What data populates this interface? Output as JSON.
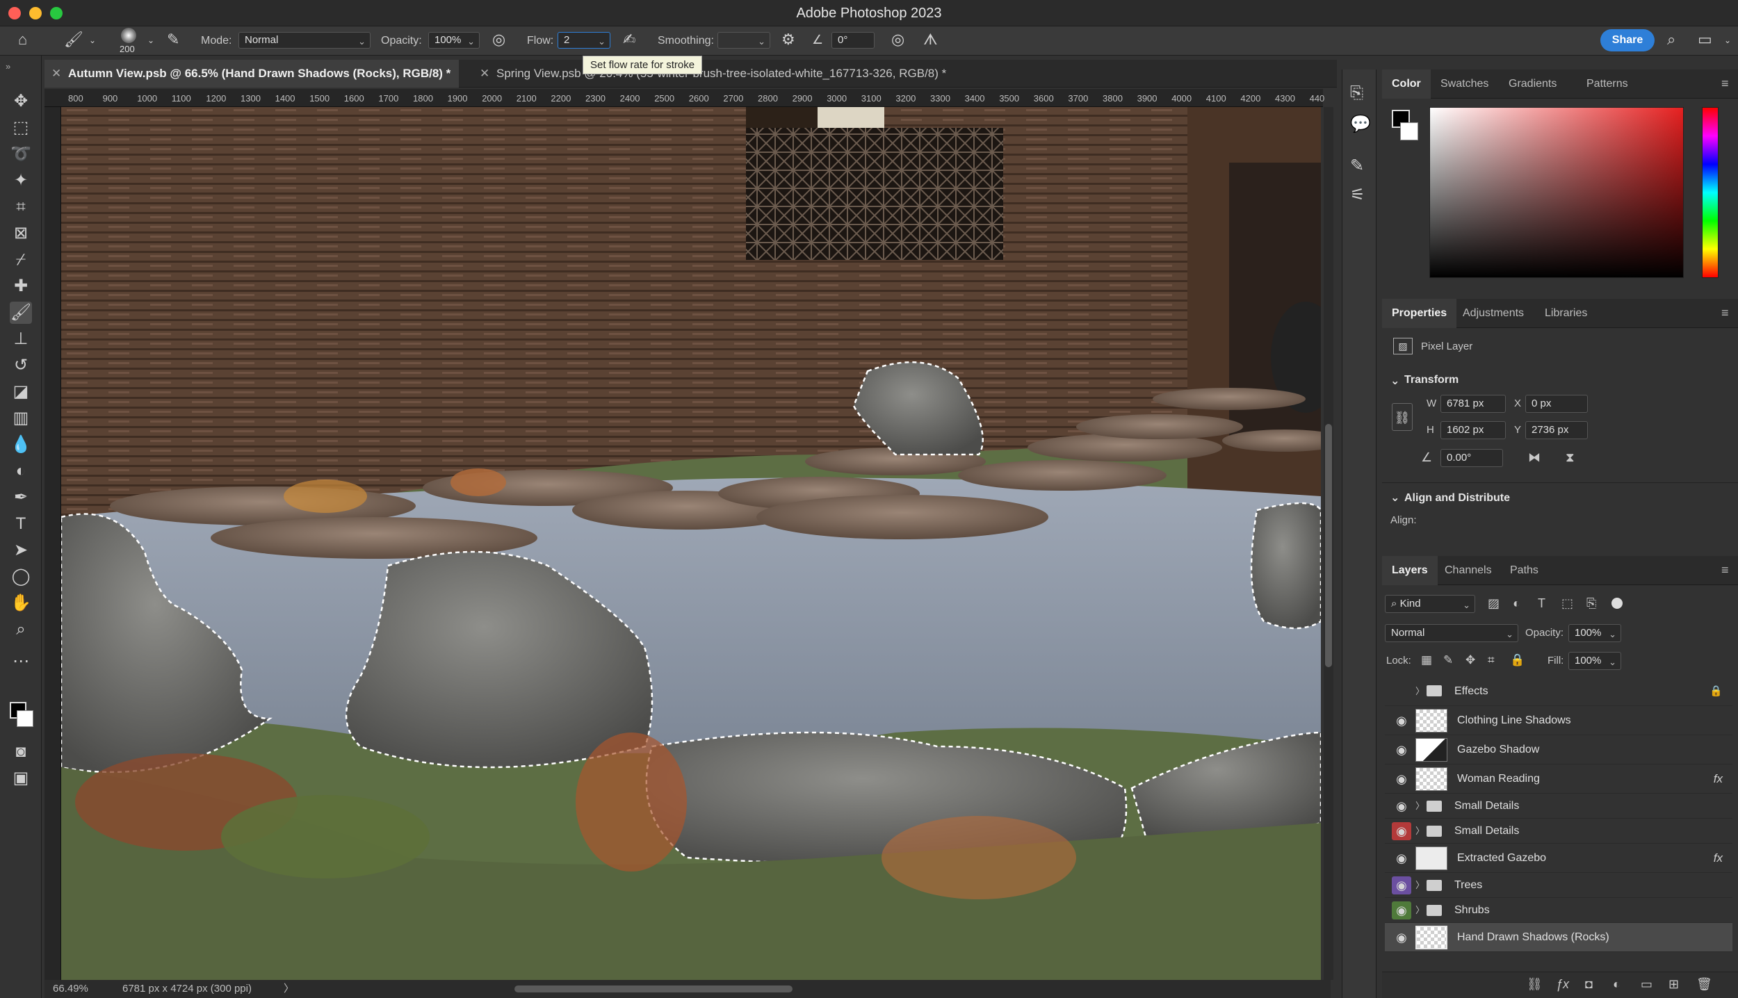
{
  "app": {
    "title": "Adobe Photoshop 2023"
  },
  "colors": {
    "accent": "#2e7fd8",
    "selected_layer": "#4a4a4a",
    "eye_red": "#b33a3a",
    "eye_purple": "#6b4fa0",
    "eye_green": "#4f7a3a"
  },
  "options": {
    "brush_size": "200",
    "mode_label": "Mode:",
    "mode_value": "Normal",
    "opacity_label": "Opacity:",
    "opacity_value": "100%",
    "flow_label": "Flow:",
    "flow_value": "2",
    "smoothing_label": "Smoothing:",
    "smoothing_value": "",
    "angle_value": "0°",
    "share_label": "Share",
    "tooltip": "Set flow rate for stroke"
  },
  "tabs": [
    {
      "label": "Autumn View.psb @ 66.5% (Hand Drawn Shadows (Rocks), RGB/8) *"
    },
    {
      "label": "Spring View.psb @ 20.4% (55-winter-brush-tree-isolated-white_167713-326, RGB/8) *"
    }
  ],
  "ruler": {
    "ticks": [
      "800",
      "900",
      "1000",
      "1100",
      "1200",
      "1300",
      "1400",
      "1500",
      "1600",
      "1700",
      "1800",
      "1900",
      "2000",
      "2100",
      "2200",
      "2300",
      "2400",
      "2500",
      "2600",
      "2700",
      "2800",
      "2900",
      "3000",
      "3100",
      "3200",
      "3300",
      "3400",
      "3500",
      "3600",
      "3700",
      "3800",
      "3900",
      "4000",
      "4100",
      "4200",
      "4300",
      "440"
    ]
  },
  "status": {
    "zoom": "66.49%",
    "doc_info": "6781 px x 4724 px (300 ppi)"
  },
  "color_panel": {
    "tabs": [
      "Color",
      "Swatches",
      "Gradients",
      "Patterns"
    ]
  },
  "properties_panel": {
    "tabs": [
      "Properties",
      "Adjustments",
      "Libraries"
    ],
    "kind": "Pixel Layer",
    "transform_title": "Transform",
    "w_label": "W",
    "w_value": "6781 px",
    "h_label": "H",
    "h_value": "1602 px",
    "x_label": "X",
    "x_value": "0 px",
    "y_label": "Y",
    "y_value": "2736 px",
    "angle_value": "0.00°",
    "align_title": "Align and Distribute",
    "align_label": "Align:"
  },
  "layers_panel": {
    "tabs": [
      "Layers",
      "Channels",
      "Paths"
    ],
    "filter_kind": "Kind",
    "blend_mode": "Normal",
    "opacity_label": "Opacity:",
    "opacity_value": "100%",
    "lock_label": "Lock:",
    "fill_label": "Fill:",
    "fill_value": "100%",
    "layers": [
      {
        "name": "Effects",
        "type": "group",
        "visible": false
      },
      {
        "name": "Clothing Line Shadows",
        "type": "layer",
        "visible": true
      },
      {
        "name": "Gazebo Shadow",
        "type": "layer",
        "visible": true
      },
      {
        "name": "Woman Reading",
        "type": "layer",
        "visible": true,
        "fx": "fx"
      },
      {
        "name": "Small Details",
        "type": "group",
        "visible": true
      },
      {
        "name": "Small Details",
        "type": "group",
        "visible": true,
        "eye_color": "red"
      },
      {
        "name": "Extracted Gazebo",
        "type": "layer",
        "visible": true,
        "fx": "fx"
      },
      {
        "name": "Trees",
        "type": "group",
        "visible": true,
        "eye_color": "purple"
      },
      {
        "name": "Shrubs",
        "type": "group",
        "visible": true,
        "eye_color": "green"
      },
      {
        "name": "Hand Drawn Shadows (Rocks)",
        "type": "layer",
        "visible": true,
        "selected": true
      }
    ]
  }
}
